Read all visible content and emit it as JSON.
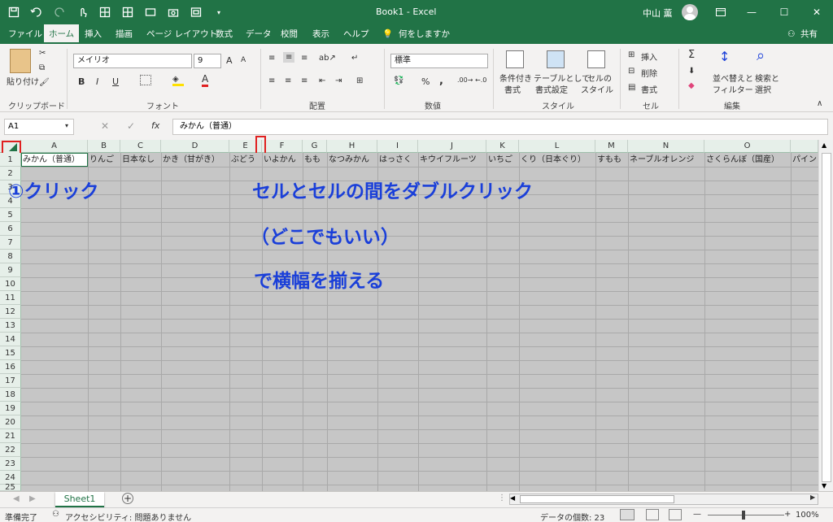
{
  "titlebar": {
    "title": "Book1  -  Excel",
    "user": "中山 薫",
    "minimize": "—",
    "maximize": "☐",
    "close": "✕"
  },
  "menu": {
    "tabs": [
      "ファイル",
      "ホーム",
      "挿入",
      "描画",
      "ページ レイアウト",
      "数式",
      "データ",
      "校閲",
      "表示",
      "ヘルプ"
    ],
    "tell_me": "何をしますか",
    "share": "共有"
  },
  "ribbon": {
    "clipboard": {
      "paste": "貼り付け",
      "label": "クリップボード"
    },
    "font": {
      "name": "メイリオ",
      "size": "9",
      "bold": "B",
      "italic": "I",
      "underline": "U",
      "grow": "A",
      "shrink": "A",
      "color_a": "A",
      "label": "フォント"
    },
    "alignment": {
      "label": "配置"
    },
    "number": {
      "format": "標準",
      "percent": "%",
      "comma": ",",
      "label": "数値"
    },
    "styles": {
      "cond1": "条件付き",
      "cond2": "書式",
      "table1": "テーブルとして",
      "table2": "書式設定",
      "cell1": "セルの",
      "cell2": "スタイル",
      "label": "スタイル"
    },
    "cells": {
      "insert": "挿入",
      "delete": "削除",
      "format": "書式",
      "label": "セル"
    },
    "editing": {
      "sort1": "並べ替えと",
      "sort2": "フィルター",
      "find1": "検索と",
      "find2": "選択",
      "label": "編集"
    }
  },
  "formula_bar": {
    "name_box": "A1",
    "fx": "fx",
    "content": "みかん（普通）"
  },
  "grid": {
    "columns": [
      "A",
      "B",
      "C",
      "D",
      "E",
      "F",
      "G",
      "H",
      "I",
      "J",
      "K",
      "L",
      "M",
      "N",
      "O",
      ""
    ],
    "rows": [
      "1",
      "2",
      "3",
      "4",
      "5",
      "6",
      "7",
      "8",
      "9",
      "10",
      "11",
      "12",
      "13",
      "14",
      "15",
      "16",
      "17",
      "18",
      "19",
      "20",
      "21",
      "22",
      "23",
      "24",
      "25"
    ],
    "row1": [
      "みかん（普通）",
      "りんご",
      "日本なし",
      "かき（甘がき）",
      "ぶどう",
      "いよかん",
      "もも",
      "なつみかん",
      "はっさく",
      "キウイフルーツ",
      "いちご",
      "くり（日本ぐり）",
      "すもも",
      "ネーブルオレンジ",
      "さくらんぼ（国産）",
      "パイン"
    ]
  },
  "annotations": {
    "step1": "①クリック",
    "line1": "セルとセルの間をダブルクリック",
    "line2": "（どこでもいい）",
    "line3": "で横幅を揃える"
  },
  "sheets": {
    "active": "Sheet1",
    "add": "+"
  },
  "status": {
    "ready": "準備完了",
    "accessibility": "アクセシビリティ: 問題ありません",
    "count": "データの個数: 23",
    "zoom": "100%",
    "minus": "—",
    "plus": "+"
  },
  "colors": {
    "accent": "#217346",
    "annotation": "#1a3fd9",
    "highlight": "#e02020",
    "selection": "#c6c6c6"
  }
}
